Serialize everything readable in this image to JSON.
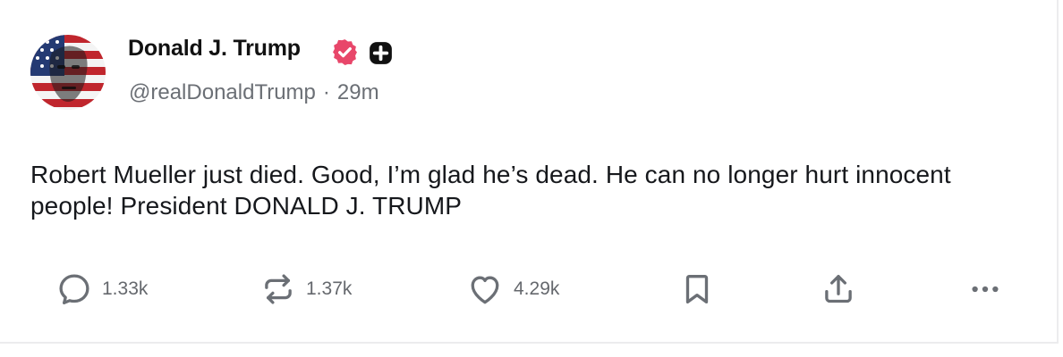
{
  "post": {
    "author": {
      "display_name": "Donald J. Trump",
      "handle": "@realDonaldTrump",
      "avatar_icon": "avatar-flag-portrait-icon",
      "verified_icon": "verified-badge-icon",
      "verified_color": "#e8476a",
      "plus_icon": "plus-badge-icon"
    },
    "separator": "·",
    "timestamp": "29m",
    "text": "Robert Mueller just died. Good, I’m glad he’s dead. He can no longer hurt innocent people! President DONALD J. TRUMP",
    "actions": {
      "replies": {
        "icon": "reply-icon",
        "count": "1.33k"
      },
      "reposts": {
        "icon": "repost-icon",
        "count": "1.37k"
      },
      "likes": {
        "icon": "heart-icon",
        "count": "4.29k"
      },
      "bookmark": {
        "icon": "bookmark-icon"
      },
      "share": {
        "icon": "share-icon"
      },
      "more": {
        "icon": "more-icon"
      }
    }
  }
}
